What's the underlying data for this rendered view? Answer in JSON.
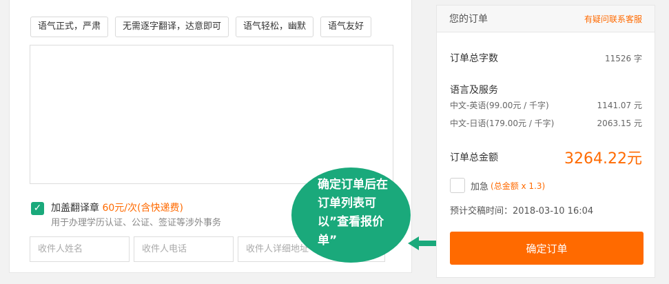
{
  "tone_tags": [
    "语气正式，严肃",
    "无需逐字翻译，达意即可",
    "语气轻松，幽默",
    "语气友好"
  ],
  "seal": {
    "label": "加盖翻译章",
    "price": "60元/次(含快递费)",
    "description": "用于办理学历认证、公证、签证等涉外事务"
  },
  "inputs": {
    "name_placeholder": "收件人姓名",
    "phone_placeholder": "收件人电话",
    "address_placeholder": "收件人详细地址"
  },
  "bubble": {
    "lines": [
      "确定订单后在",
      "订单列表可",
      "以”查看报价",
      "单”"
    ]
  },
  "order": {
    "title": "您的订单",
    "contact": "有疑问联系客服",
    "word_count_label": "订单总字数",
    "word_count_value": "11526 字",
    "services_label": "语言及服务",
    "services": [
      {
        "name": "中文-英语(99.00元 / 千字)",
        "price": "1141.07 元"
      },
      {
        "name": "中文-日语(179.00元 / 千字)",
        "price": "2063.15 元"
      }
    ],
    "total_label": "订单总金额",
    "total_value": "3264.22元",
    "urgent_label": "加急",
    "urgent_note": "(总金额 x 1.3)",
    "eta": "预计交稿时间：2018-03-10 16:04",
    "confirm_label": "确定订单"
  },
  "colors": {
    "accent_orange": "#ff6a00",
    "accent_green": "#1aa97b"
  }
}
